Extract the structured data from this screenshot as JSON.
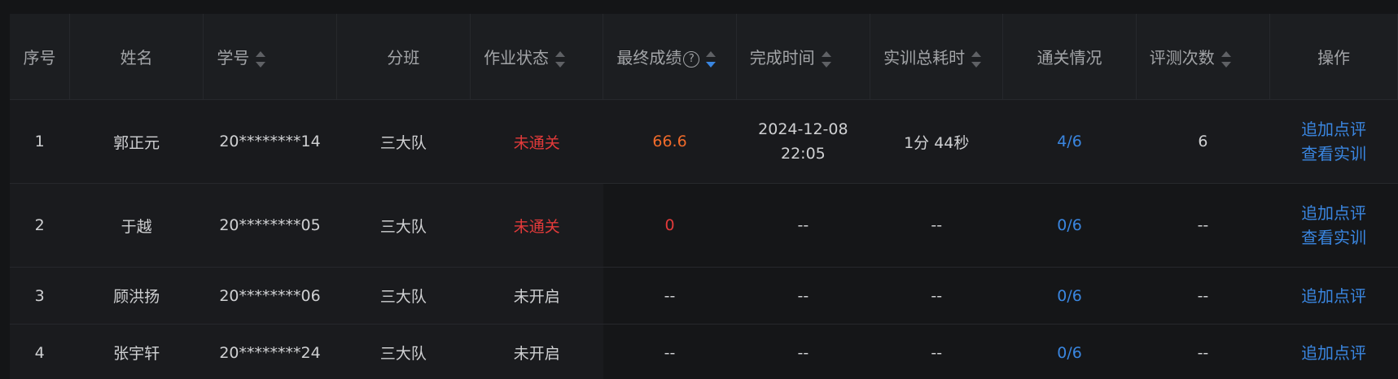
{
  "headers": {
    "index": "序号",
    "name": "姓名",
    "student_id": "学号",
    "class": "分班",
    "status": "作业状态",
    "final_score": "最终成绩",
    "finish_time": "完成时间",
    "total_time": "实训总耗时",
    "pass_status": "通关情况",
    "eval_count": "评测次数",
    "actions": "操作"
  },
  "help_glyph": "?",
  "action_labels": {
    "add_comment": "追加点评",
    "view_training": "查看实训"
  },
  "colors": {
    "fail": "#e23a3a",
    "score": "#f06a2a",
    "link": "#3a86e0"
  },
  "rows": [
    {
      "index": "1",
      "name": "郭正元",
      "student_id": "20********14",
      "class": "三大队",
      "status": "未通关",
      "score": "66.6",
      "finish_date": "2024-12-08",
      "finish_clock": "22:05",
      "total_time": "1分 44秒",
      "pass": "4/6",
      "evals": "6"
    },
    {
      "index": "2",
      "name": "于越",
      "student_id": "20********05",
      "class": "三大队",
      "status": "未通关",
      "score": "0",
      "finish_date": "--",
      "finish_clock": "",
      "total_time": "--",
      "pass": "0/6",
      "evals": "--"
    },
    {
      "index": "3",
      "name": "顾洪扬",
      "student_id": "20********06",
      "class": "三大队",
      "status": "未开启",
      "score": "--",
      "finish_date": "--",
      "finish_clock": "",
      "total_time": "--",
      "pass": "0/6",
      "evals": "--"
    },
    {
      "index": "4",
      "name": "张宇轩",
      "student_id": "20********24",
      "class": "三大队",
      "status": "未开启",
      "score": "--",
      "finish_date": "--",
      "finish_clock": "",
      "total_time": "--",
      "pass": "0/6",
      "evals": "--"
    }
  ]
}
